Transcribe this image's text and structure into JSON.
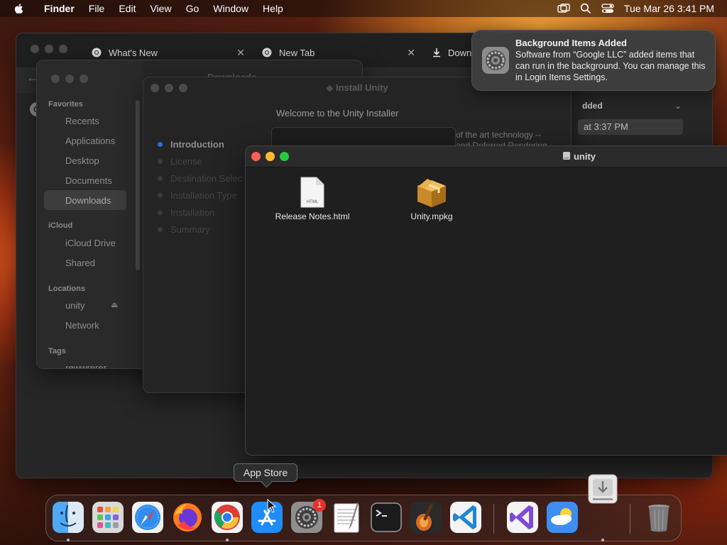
{
  "menubar": {
    "app": "Finder",
    "items": [
      "File",
      "Edit",
      "View",
      "Go",
      "Window",
      "Help"
    ],
    "datetime": "Tue Mar 26  3:41 PM"
  },
  "chrome": {
    "tabs": [
      {
        "label": "What's New"
      },
      {
        "label": "New Tab"
      },
      {
        "label": "Downl"
      }
    ],
    "downloads_header": "dded",
    "downloads_row": "at 3:37 PM"
  },
  "finder": {
    "title": "Downloads",
    "sidebar": {
      "favorites_head": "Favorites",
      "favorites": [
        "Recents",
        "Applications",
        "Desktop",
        "Documents",
        "Downloads"
      ],
      "icloud_head": "iCloud",
      "icloud": [
        "iCloud Drive",
        "Shared"
      ],
      "locations_head": "Locations",
      "locations": [
        "unity",
        "Network"
      ],
      "tags_head": "Tags",
      "tags": [
        "rewwrerer"
      ]
    }
  },
  "installer": {
    "title": "Install Unity",
    "welcome": "Welcome to the Unity Installer",
    "steps": [
      "Introduction",
      "License",
      "Destination Selec",
      "Installation Type",
      "Installation",
      "Summary"
    ],
    "text_line1": "of the art technology --",
    "text_line2": "and Deferred Rendering"
  },
  "unity_window": {
    "title": "unity",
    "files": [
      {
        "name": "Release Notes.html",
        "icon": "html-file-icon",
        "icon_text": "HTML"
      },
      {
        "name": "Unity.mpkg",
        "icon": "package-icon"
      }
    ]
  },
  "notification": {
    "title": "Background Items Added",
    "body": "Software from “Google LLC” added items that can run in the background. You can manage this in Login Items Settings."
  },
  "tooltip": {
    "label": "App Store"
  },
  "dock": {
    "items": [
      "Finder",
      "Launchpad",
      "Safari",
      "Firefox",
      "Google Chrome",
      "App Store",
      "System Settings",
      "TextEdit",
      "Terminal",
      "GarageBand",
      "Visual Studio Code",
      "Visual Studio",
      "Weather",
      "Trash"
    ],
    "badge": "1"
  },
  "colors": {
    "accent": "#2d6fd8",
    "close": "#fe5f57",
    "minimize": "#febc2e",
    "zoom": "#28c840",
    "badge": "#e5322b"
  }
}
